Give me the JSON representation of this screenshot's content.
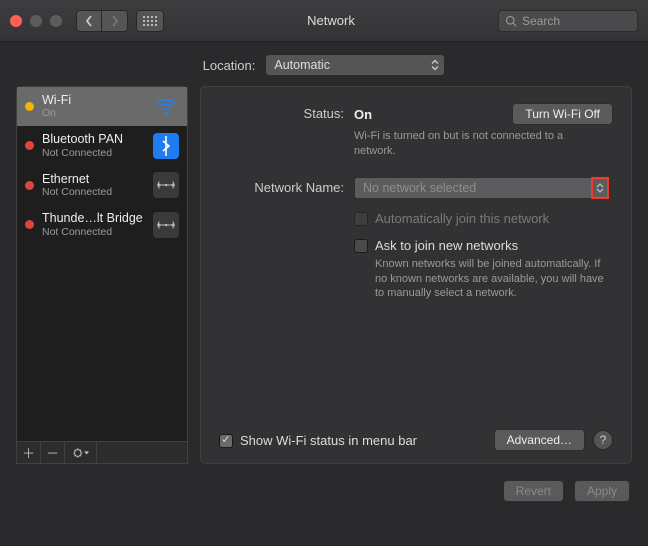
{
  "window": {
    "title": "Network",
    "search_placeholder": "Search"
  },
  "location": {
    "label": "Location:",
    "value": "Automatic"
  },
  "sidebar": {
    "items": [
      {
        "name": "Wi-Fi",
        "sub": "On",
        "dot": "#f5b400",
        "icon": "wifi",
        "icon_bg": "transparent",
        "selected": true
      },
      {
        "name": "Bluetooth PAN",
        "sub": "Not Connected",
        "dot": "#e0443e",
        "icon": "bluetooth",
        "icon_bg": "#1f7cf0"
      },
      {
        "name": "Ethernet",
        "sub": "Not Connected",
        "dot": "#e0443e",
        "icon": "ethernet",
        "icon_bg": "#3a3a3a"
      },
      {
        "name": "Thunde…lt Bridge",
        "sub": "Not Connected",
        "dot": "#e0443e",
        "icon": "ethernet",
        "icon_bg": "#3a3a3a"
      }
    ]
  },
  "status": {
    "label": "Status:",
    "value": "On",
    "button": "Turn Wi-Fi Off",
    "detail": "Wi-Fi is turned on but is not connected to a network."
  },
  "network_name": {
    "label": "Network Name:",
    "value": "No network selected"
  },
  "auto_join": {
    "label": "Automatically join this network",
    "checked": false,
    "disabled": true
  },
  "ask_join": {
    "label": "Ask to join new networks",
    "checked": false,
    "detail": "Known networks will be joined automatically. If no known networks are available, you will have to manually select a network."
  },
  "menubar": {
    "label": "Show Wi-Fi status in menu bar",
    "checked": true
  },
  "buttons": {
    "advanced": "Advanced…",
    "revert": "Revert",
    "apply": "Apply"
  },
  "colors": {
    "traffic_close": "#5c5c5c",
    "traffic_min": "#5c5c5c",
    "traffic_max": "#5c5c5c"
  }
}
